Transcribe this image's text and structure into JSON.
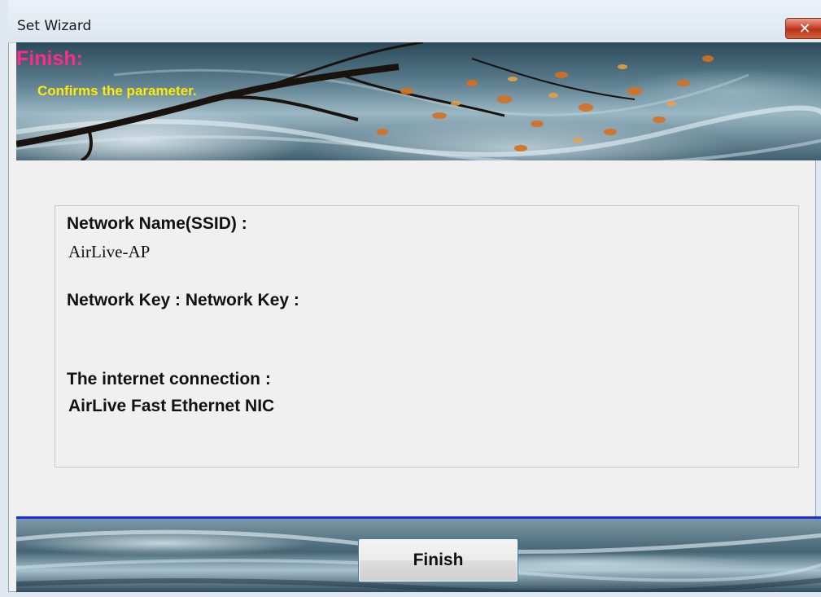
{
  "window": {
    "title": "Set Wizard",
    "close_icon": "close-icon"
  },
  "banner": {
    "title": "Finish:",
    "subtitle": "Confirms the parameter."
  },
  "summary": {
    "ssid_label": "Network Name(SSID) :",
    "ssid_value": "AirLive-AP",
    "key_label": "Network Key : Network Key :",
    "key_value": "",
    "connection_label": "The internet connection :",
    "connection_value": "AirLive Fast Ethernet NIC"
  },
  "footer": {
    "finish_label": "Finish"
  },
  "colors": {
    "banner_title": "#ff2a8a",
    "banner_subtitle": "#ffea00",
    "separator": "#1a2fe0",
    "close_button": "#c8452d"
  }
}
